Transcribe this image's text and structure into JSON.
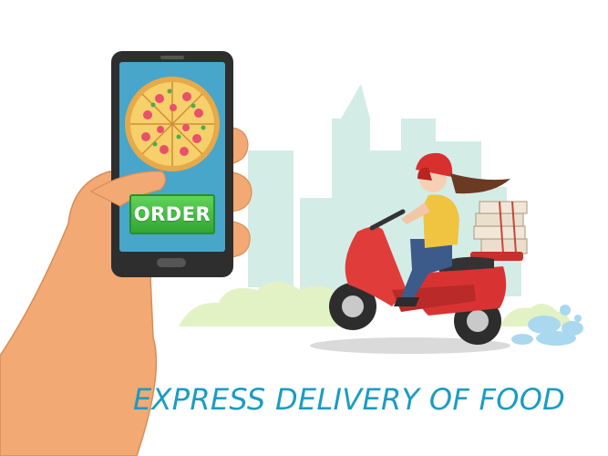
{
  "order_button": {
    "label": "ORDER"
  },
  "headline": "EXPRESS DELIVERY OF FOOD",
  "colors": {
    "headline": "#1b9cc4",
    "order_button": "#3cb43c",
    "phone_body": "#2e2e2e",
    "phone_screen": "#47a6c9",
    "helmet": "#e23b3b",
    "scooter": "#e03838",
    "skyline": "#d4ece6",
    "bushes": "#e3f2c5"
  }
}
